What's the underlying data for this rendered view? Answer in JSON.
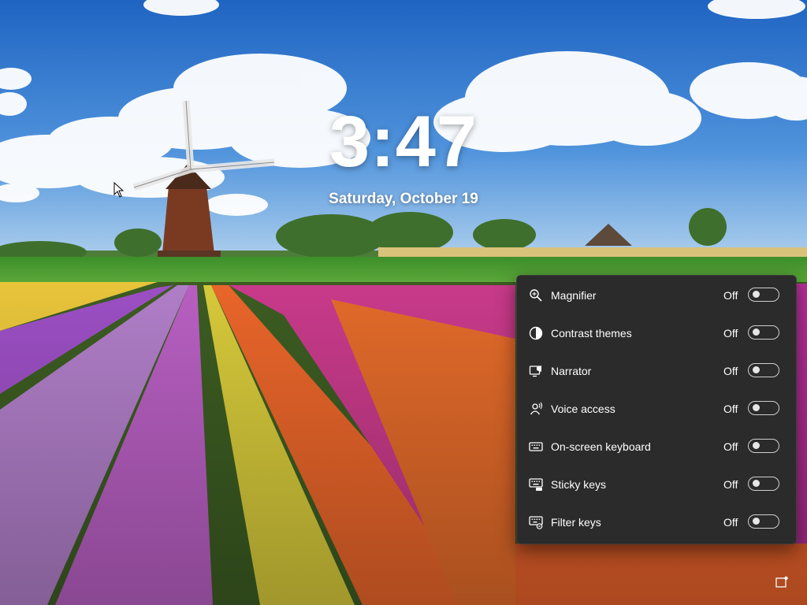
{
  "lockscreen": {
    "time": "3:47",
    "date": "Saturday, October 19"
  },
  "accessibility_panel": {
    "items": [
      {
        "label": "Magnifier",
        "state": "Off",
        "icon": "magnifier-icon"
      },
      {
        "label": "Contrast themes",
        "state": "Off",
        "icon": "contrast-icon"
      },
      {
        "label": "Narrator",
        "state": "Off",
        "icon": "narrator-icon"
      },
      {
        "label": "Voice access",
        "state": "Off",
        "icon": "voice-access-icon"
      },
      {
        "label": "On-screen keyboard",
        "state": "Off",
        "icon": "keyboard-icon"
      },
      {
        "label": "Sticky keys",
        "state": "Off",
        "icon": "sticky-keys-icon"
      },
      {
        "label": "Filter keys",
        "state": "Off",
        "icon": "filter-keys-icon"
      }
    ]
  },
  "colors": {
    "panel_background": "#2b2b2b",
    "text": "#ffffff",
    "sky": "#2a6fc4"
  }
}
